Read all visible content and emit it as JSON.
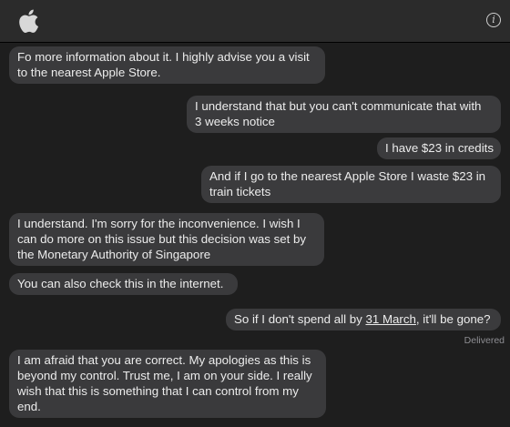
{
  "header": {
    "logo": "apple-logo",
    "info_icon": "info-icon"
  },
  "messages": [
    {
      "dir": "in",
      "lines": [
        "Fo more information about it. I highly advise you a visit",
        "to the nearest Apple Store."
      ]
    },
    {
      "dir": "out",
      "lines": [
        "I understand that but you can't communicate that with",
        "3 weeks notice"
      ]
    },
    {
      "dir": "out",
      "lines": [
        "I have $23 in credits"
      ]
    },
    {
      "dir": "out",
      "lines": [
        "And if I go to the nearest Apple Store I waste $23 in",
        "train tickets"
      ]
    },
    {
      "dir": "in",
      "lines": [
        "I understand. I'm sorry for the inconvenience. I wish I",
        "can do more on this issue but this decision was set by",
        "the Monetary Authority of Singapore"
      ]
    },
    {
      "dir": "in",
      "lines": [
        "You can also check this in the internet."
      ]
    },
    {
      "dir": "out",
      "pre": "So if I don't spend all by ",
      "link": "31 March",
      "post": ", it'll be gone?"
    },
    {
      "dir": "in",
      "lines": [
        "I am afraid that you are correct. My apologies as this is",
        "beyond my control. Trust me, I am on your side. I really",
        "wish that this is something that I can control from my",
        "end."
      ]
    }
  ],
  "status": {
    "delivered": "Delivered"
  }
}
